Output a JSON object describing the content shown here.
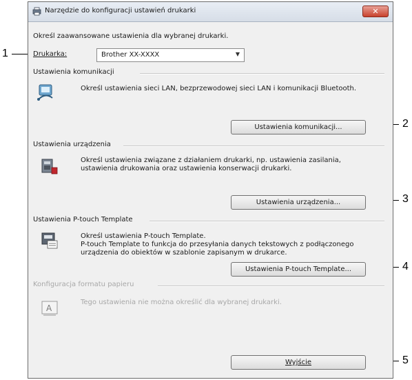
{
  "window": {
    "title": "Narzędzie do konfiguracji ustawień drukarki",
    "close_label": "✕"
  },
  "intro": "Określ zaawansowane ustawienia dla wybranej drukarki.",
  "printer": {
    "label": "Drukarka:",
    "value": "Brother XX-XXXX"
  },
  "sections": {
    "communication": {
      "title": "Ustawienia komunikacji",
      "description": "Określ ustawienia sieci LAN, bezprzewodowej sieci LAN i komunikacji Bluetooth.",
      "button": "Ustawienia komunikacji..."
    },
    "device": {
      "title": "Ustawienia urządzenia",
      "description_line1": "Określ ustawienia związane z działaniem drukarki, np. ustawienia zasilania,",
      "description_line2": "ustawienia drukowania oraz ustawienia konserwacji drukarki.",
      "button": "Ustawienia urządzenia..."
    },
    "ptouch": {
      "title": "Ustawienia P-touch Template",
      "description_line1": "Określ ustawienia P-touch Template.",
      "description_line2": "P-touch Template to funkcja do przesyłania danych tekstowych z podłączonego",
      "description_line3": "urządzenia do obiektów w szablonie zapisanym w drukarce.",
      "button": "Ustawienia P-touch Template..."
    },
    "paper": {
      "title": "Konfiguracja formatu papieru",
      "description": "Tego ustawienia nie można określić dla wybranej drukarki."
    }
  },
  "exit_button": "Wyjście",
  "callouts": [
    "1",
    "2",
    "3",
    "4",
    "5"
  ]
}
